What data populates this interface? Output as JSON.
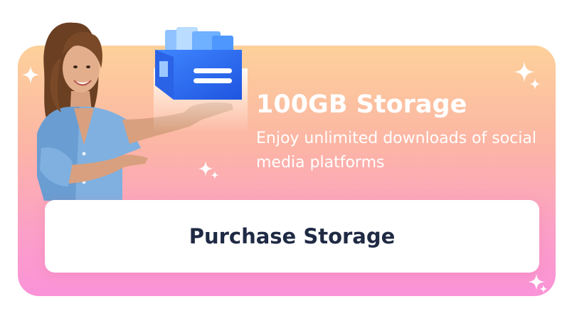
{
  "promo": {
    "title": "100GB Storage",
    "description": "Enjoy unlimited downloads of social media platforms",
    "button_label": "Purchase Storage"
  },
  "colors": {
    "card_top": "#fdd19a",
    "card_bottom": "#fb93d8",
    "text_light": "#ffffff",
    "button_text": "#1f2a44",
    "icon_blue": "#2f6ff0"
  },
  "icons": {
    "storage": "storage-box-icon",
    "sparkle": "sparkle-icon"
  }
}
